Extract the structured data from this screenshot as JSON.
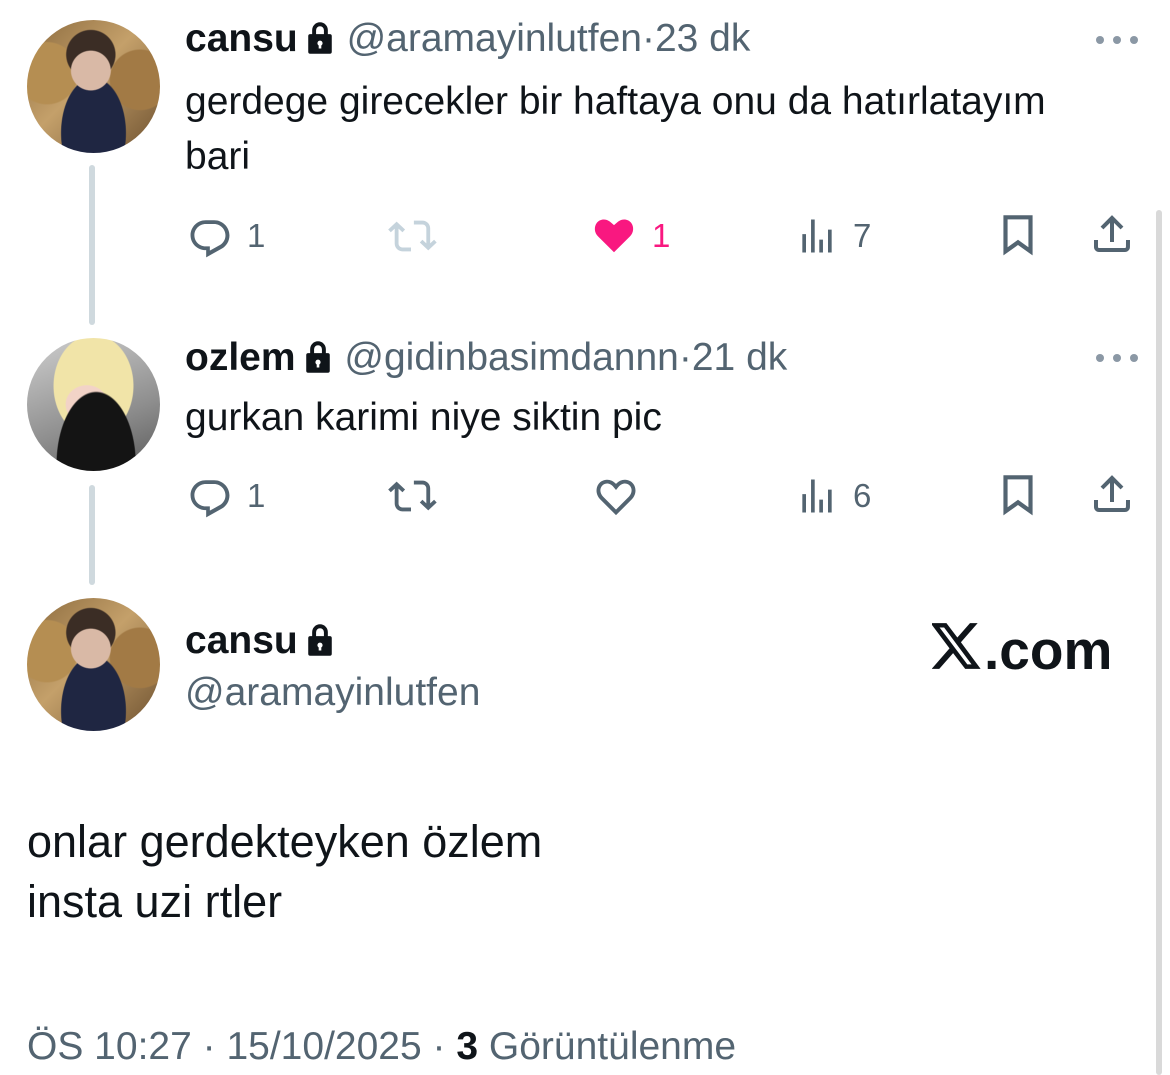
{
  "thread": [
    {
      "display_name": "cansu",
      "handle": "@aramayinlutfen",
      "separator": "·",
      "time": "23 dk",
      "text": "gerdege girecekler bir haftaya onu da hatırlatayım bari",
      "replies": "1",
      "likes": "1",
      "views": "7",
      "liked": true
    },
    {
      "display_name": "ozlem",
      "handle": "@gidinbasimdannn",
      "separator": "·",
      "time": "21 dk",
      "text": "gurkan karimi niye siktin pic",
      "replies": "1",
      "likes": "",
      "views": "6",
      "liked": false
    }
  ],
  "main_tweet": {
    "display_name": "cansu",
    "handle": "@aramayinlutfen",
    "brand": ".com",
    "text": "onlar gerdekteyken özlem\ninsta uzi rtler",
    "time": "ÖS 10:27",
    "separator": "·",
    "date": "15/10/2025",
    "views_count": "3",
    "views_label": "Görüntülenme"
  },
  "colors": {
    "text": "#0f1419",
    "secondary": "#536471",
    "like": "#f91880",
    "thread_line": "#cfd9de",
    "retweet_disabled": "#c5d3dc"
  },
  "icons": [
    "lock-icon",
    "more-icon",
    "reply-icon",
    "retweet-icon",
    "heart-icon",
    "views-icon",
    "bookmark-icon",
    "share-icon",
    "x-logo-icon"
  ]
}
